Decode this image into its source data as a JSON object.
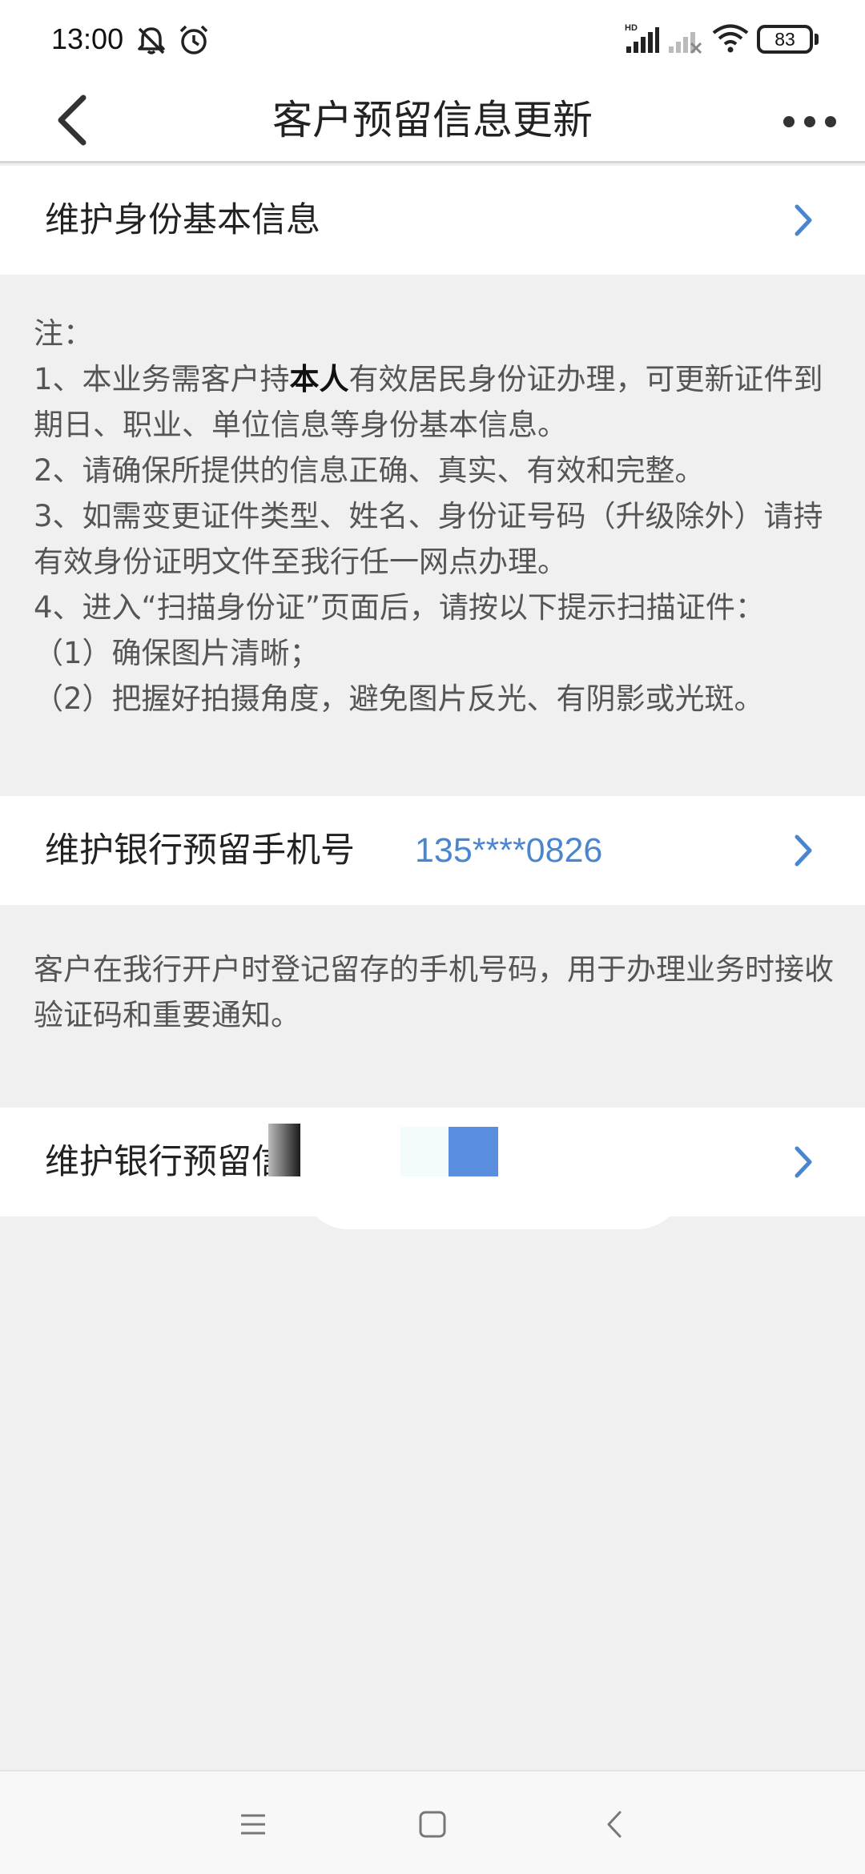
{
  "status_bar": {
    "time": "13:00",
    "left_icons": [
      "bell-off-icon",
      "alarm-clock-icon"
    ],
    "right_icons": [
      "hd-signal-icon",
      "no-signal-icon",
      "wifi-icon"
    ],
    "network_badge": "HD",
    "battery": "83"
  },
  "header": {
    "back_icon": "chevron-left-icon",
    "title": "客户预留信息更新",
    "more_icon": "more-horizontal-icon"
  },
  "identity_row": {
    "label": "维护身份基本信息",
    "chevron_icon": "chevron-right-icon"
  },
  "notes": {
    "heading": "注：",
    "item1_prefix": "1、本业务需客户持",
    "item1_bold": "本人",
    "item1_suffix": "有效居民身份证办理，可更新证件到期日、职业、单位信息等身份基本信息。",
    "item2": "2、请确保所提供的信息正确、真实、有效和完整。",
    "item3": "3、如需变更证件类型、姓名、身份证号码（升级除外）请持有效身份证明文件至我行任一网点办理。",
    "item4": "4、进入“扫描身份证”页面后，请按以下提示扫描证件：",
    "item4_sub1": "（1）确保图片清晰；",
    "item4_sub2": "（2）把握好拍摄角度，避免图片反光、有阴影或光斑。"
  },
  "phone_row": {
    "label": "维护银行预留手机号",
    "value": "135****0826",
    "chevron_icon": "chevron-right-icon"
  },
  "phone_description": "客户在我行开户时登记留存的手机号码，用于办理业务时接收验证码和重要通知。",
  "info_row": {
    "label": "维护银行预留信",
    "chevron_icon": "chevron-right-icon"
  },
  "system_nav": {
    "icons": [
      "menu-icon",
      "home-icon",
      "back-icon"
    ]
  },
  "colors": {
    "accent": "#4a86cf",
    "background": "#f0f0f0",
    "card": "#ffffff",
    "text": "#222222",
    "muted_text": "#555555"
  }
}
